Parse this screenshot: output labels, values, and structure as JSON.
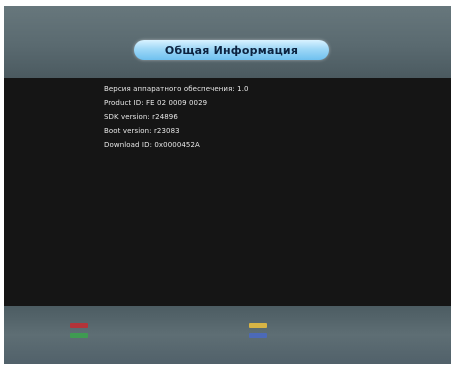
{
  "screen": {
    "title": "Общая Информация",
    "info_lines": [
      "Версия аппаратного обеспечения: 1.0",
      "Product ID: FE 02 0009 0029",
      "SDK version: r24896",
      "Boot version: r23083",
      "Download ID: 0x0000452A"
    ]
  },
  "colors": {
    "background": "#151515",
    "panel": "#5e6e74",
    "title_pill": "#9fd8f7",
    "text": "#e8e8e8",
    "key_red": "#b3343a",
    "key_green": "#3f9b52",
    "key_yellow": "#d8b445",
    "key_blue": "#4c6ab8"
  },
  "footer": {
    "keys_left": [
      "red",
      "green"
    ],
    "keys_right": [
      "yellow",
      "blue"
    ]
  }
}
